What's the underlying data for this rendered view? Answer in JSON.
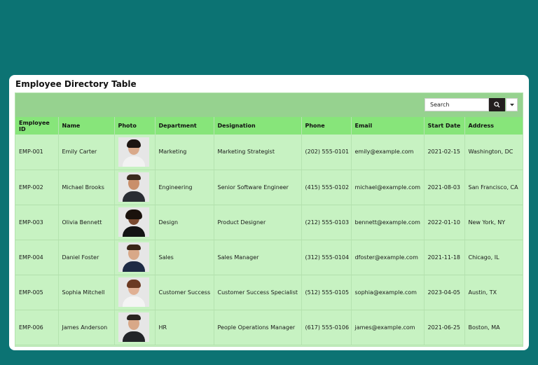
{
  "title": "Employee Directory Table",
  "search": {
    "placeholder": "Search"
  },
  "icons": {
    "search": "search-icon",
    "dropdown": "chevron-down-icon"
  },
  "colors": {
    "background": "#0c7373",
    "toolbar": "#96d28f",
    "header": "#87e57a",
    "rows": "#c7f2c2",
    "search_button": "#231e1e"
  },
  "columns": [
    "Employee ID",
    "Name",
    "Photo",
    "Department",
    "Designation",
    "Phone",
    "Email",
    "Start Date",
    "Address"
  ],
  "rows": [
    {
      "id": "EMP-001",
      "name": "Emily Carter",
      "department": "Marketing",
      "designation": "Marketing Strategist",
      "phone": "(202) 555-0101",
      "email": "emily@example.com",
      "start_date": "2021-02-15",
      "address": "Washington, DC"
    },
    {
      "id": "EMP-002",
      "name": "Michael Brooks",
      "department": "Engineering",
      "designation": "Senior Software Engineer",
      "phone": "(415) 555-0102",
      "email": "michael@example.com",
      "start_date": "2021-08-03",
      "address": "San Francisco, CA"
    },
    {
      "id": "EMP-003",
      "name": "Olivia Bennett",
      "department": "Design",
      "designation": "Product Designer",
      "phone": "(212) 555-0103",
      "email": "bennett@example.com",
      "start_date": "2022-01-10",
      "address": "New York, NY"
    },
    {
      "id": "EMP-004",
      "name": "Daniel Foster",
      "department": "Sales",
      "designation": "Sales Manager",
      "phone": "(312) 555-0104",
      "email": "dfoster@example.com",
      "start_date": "2021-11-18",
      "address": "Chicago, IL"
    },
    {
      "id": "EMP-005",
      "name": "Sophia Mitchell",
      "department": "Customer Success",
      "designation": "Customer Success Specialist",
      "phone": "(512) 555-0105",
      "email": "sophia@example.com",
      "start_date": "2023-04-05",
      "address": "Austin, TX"
    },
    {
      "id": "EMP-006",
      "name": "James Anderson",
      "department": "HR",
      "designation": "People Operations Manager",
      "phone": "(617) 555-0106",
      "email": "james@example.com",
      "start_date": "2021-06-25",
      "address": "Boston, MA"
    }
  ]
}
